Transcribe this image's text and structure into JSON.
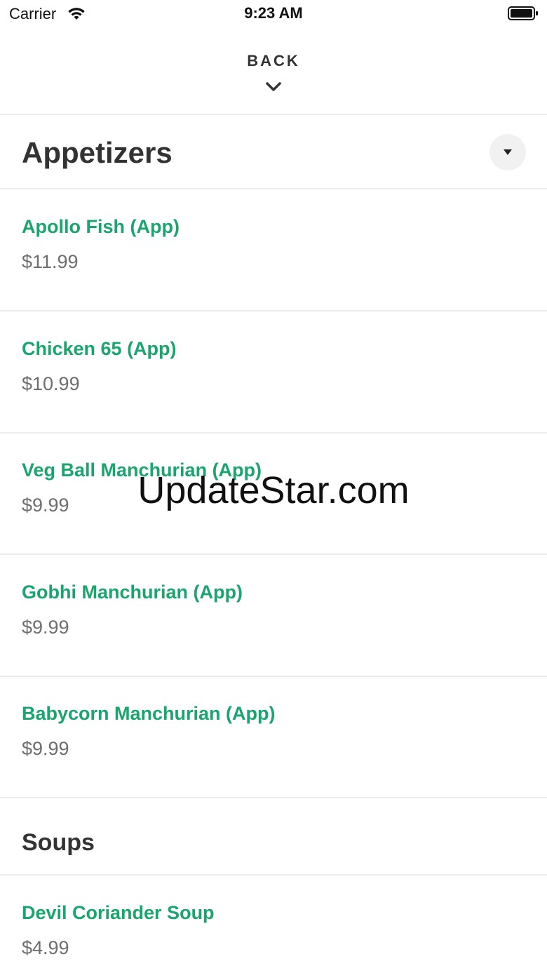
{
  "status_bar": {
    "carrier": "Carrier",
    "time": "9:23 AM"
  },
  "header": {
    "back_label": "BACK"
  },
  "sections": [
    {
      "title": "Appetizers",
      "items": [
        {
          "name": "Apollo Fish (App)",
          "price": "$11.99"
        },
        {
          "name": "Chicken 65 (App)",
          "price": "$10.99"
        },
        {
          "name": "Veg Ball Manchurian (App)",
          "price": "$9.99"
        },
        {
          "name": "Gobhi Manchurian (App)",
          "price": "$9.99"
        },
        {
          "name": "Babycorn Manchurian (App)",
          "price": "$9.99"
        }
      ]
    },
    {
      "title": "Soups",
      "items": [
        {
          "name": "Devil Coriander Soup",
          "price": "$4.99"
        }
      ]
    }
  ],
  "watermark": "UpdateStar.com",
  "colors": {
    "item_name": "#1aa56e",
    "price": "#6e6e6e",
    "divider": "#ececec"
  }
}
